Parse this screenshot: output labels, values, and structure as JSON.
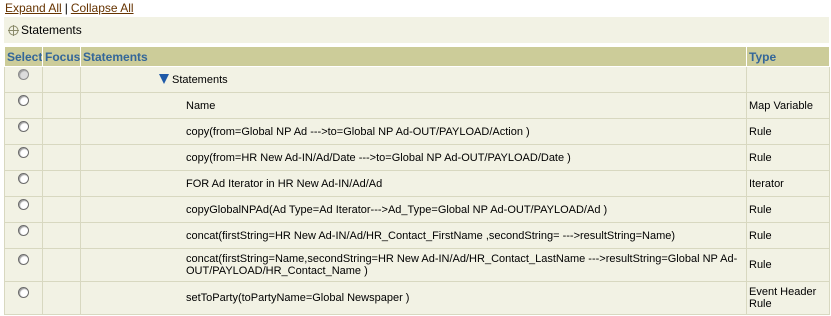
{
  "toolbar": {
    "expand_all": "Expand All",
    "separator": "|",
    "collapse_all": "Collapse All"
  },
  "crumb": {
    "label": "Statements",
    "icon": "crosshair-icon"
  },
  "table": {
    "headers": {
      "select": "Select",
      "focus": "Focus",
      "statements": "Statements",
      "type": "Type"
    },
    "root": {
      "label": "Statements"
    },
    "rows": [
      {
        "statement": "Name",
        "type": "Map Variable"
      },
      {
        "statement": "copy(from=Global NP Ad --->to=Global NP Ad-OUT/PAYLOAD/Action )",
        "type": "Rule"
      },
      {
        "statement": "copy(from=HR New Ad-IN/Ad/Date --->to=Global NP Ad-OUT/PAYLOAD/Date )",
        "type": "Rule"
      },
      {
        "statement": "FOR Ad Iterator in HR New Ad-IN/Ad/Ad",
        "type": "Iterator"
      },
      {
        "statement": "copyGlobalNPAd(Ad Type=Ad Iterator--->Ad_Type=Global NP Ad-OUT/PAYLOAD/Ad )",
        "type": "Rule"
      },
      {
        "statement": "concat(firstString=HR New Ad-IN/Ad/HR_Contact_FirstName ,secondString= --->resultString=Name)",
        "type": "Rule"
      },
      {
        "statement": "concat(firstString=Name,secondString=HR New Ad-IN/Ad/HR_Contact_LastName --->resultString=Global NP Ad-OUT/PAYLOAD/HR_Contact_Name )",
        "type": "Rule"
      },
      {
        "statement": "setToParty(toPartyName=Global Newspaper )",
        "type": "Event Header Rule"
      }
    ]
  }
}
